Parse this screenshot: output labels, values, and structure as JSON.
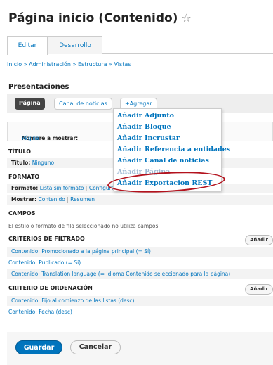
{
  "header": {
    "title": "Página inicio (Contenido)",
    "star": "☆"
  },
  "tabs": [
    {
      "label": "Editar"
    },
    {
      "label": "Desarrollo"
    }
  ],
  "breadcrumb": {
    "items": [
      "Inicio",
      "Administración",
      "Estructura",
      "Vistas"
    ],
    "separator": "»"
  },
  "section_title": "Presentaciones",
  "displays": {
    "active": "Página",
    "other": "Canal de noticias",
    "add": "+Agregar"
  },
  "dropdown": {
    "items": [
      "Añadir Adjunto",
      "Añadir Bloque",
      "Añadir Incrustar",
      "Añadir Referencia a entidades",
      "Añadir Canal de noticias",
      "Añadir Página",
      "Añadir Exportacion REST"
    ]
  },
  "mostrar": {
    "label": "Nombre a mostrar:",
    "value": "Página"
  },
  "titulo": {
    "heading": "TÍTULO",
    "label": "Título:",
    "value": "Ninguno"
  },
  "formato": {
    "heading": "FORMATO",
    "label": "Formato:",
    "value": "Lista sin formato",
    "config": "Configuración",
    "show_label": "Mostrar:",
    "show_value": "Contenido",
    "divider": "|",
    "show_alt": "Resumen"
  },
  "campos": {
    "heading": "CAMPOS",
    "text": "El estilo o formato de fila seleccionado no utiliza campos."
  },
  "filtros": {
    "heading": "CRITERIOS DE FILTRADO",
    "add": "Añadir",
    "items": [
      "Contenido: Promocionado a la página principal (= Sí)",
      "Contenido: Publicado (= Sí)",
      "Contenido: Translation language (= Idioma Contenido seleccionado para la página)"
    ]
  },
  "orden": {
    "heading": "CRITERIO DE ORDENACIÓN",
    "add": "Añadir",
    "items": [
      "Contenido: Fijo al comienzo de las listas (desc)",
      "Contenido: Fecha (desc)"
    ]
  },
  "footer": {
    "save": "Guardar",
    "cancel": "Cancelar"
  },
  "colors": {
    "accent": "#0074bd",
    "annotation": "#b3121d"
  }
}
